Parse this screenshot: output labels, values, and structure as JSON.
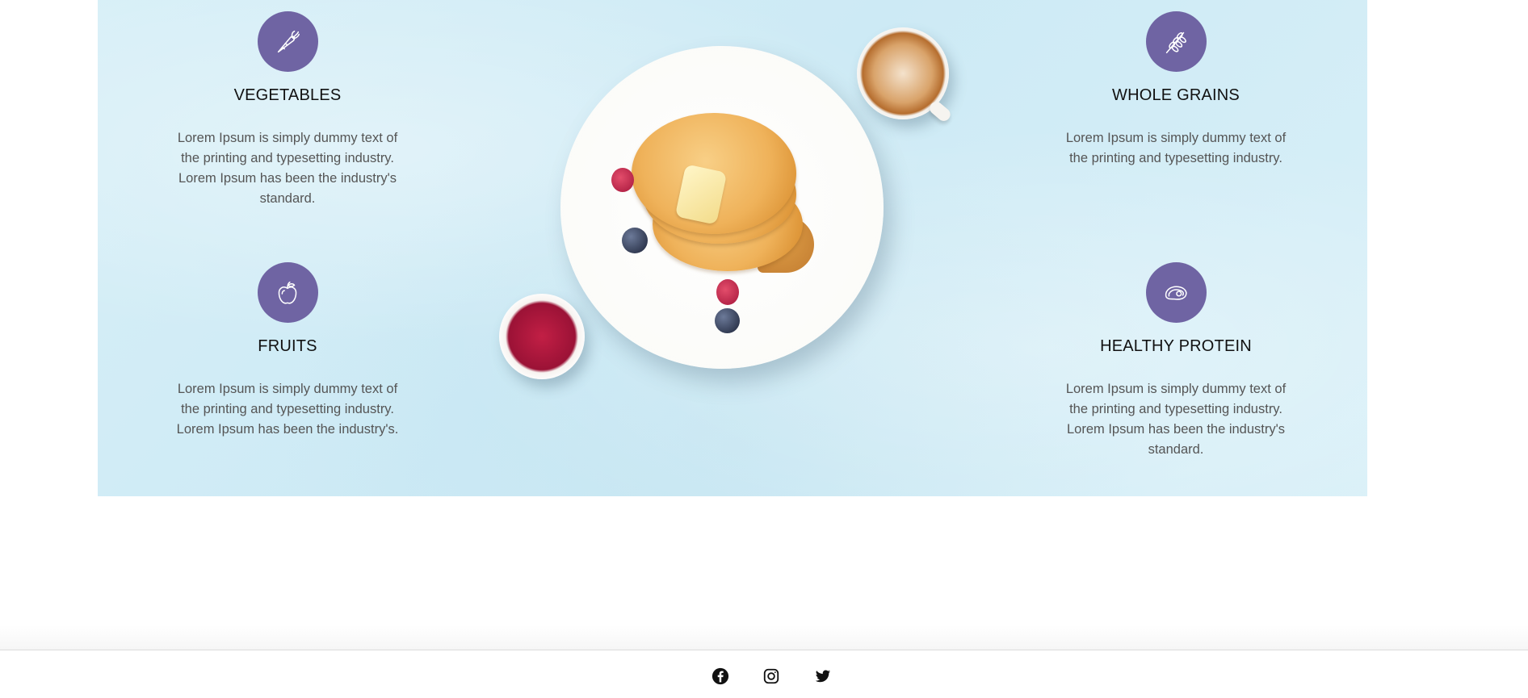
{
  "features": [
    {
      "icon": "carrot-icon",
      "title": "VEGETABLES",
      "text": "Lorem Ipsum is simply dummy text of the printing and typesetting industry. Lorem Ipsum has been the industry's standard."
    },
    {
      "icon": "wheat-icon",
      "title": "WHOLE GRAINS",
      "text": "Lorem Ipsum is simply dummy text of the printing and typesetting industry."
    },
    {
      "icon": "apple-icon",
      "title": "FRUITS",
      "text": "Lorem Ipsum is simply dummy text of the printing and typesetting industry. Lorem Ipsum has been the industry's."
    },
    {
      "icon": "steak-icon",
      "title": "HEALTHY PROTEIN",
      "text": "Lorem Ipsum is simply dummy text of the printing and typesetting industry. Lorem Ipsum has been the industry's standard."
    }
  ],
  "footer": {
    "social": [
      "facebook-icon",
      "instagram-icon",
      "twitter-icon"
    ]
  },
  "colors": {
    "accent": "#6f64a3",
    "panel_background": "#d5eef7"
  }
}
